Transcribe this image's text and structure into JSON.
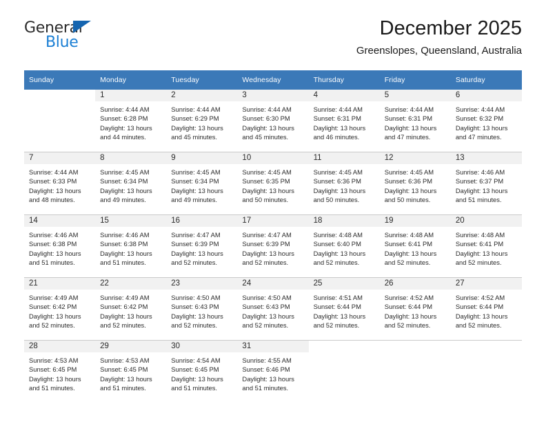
{
  "brand": {
    "name_part1": "General",
    "name_part2": "Blue",
    "accent_color": "#1b7fd4",
    "triangle_color": "#1565b0"
  },
  "header": {
    "title": "December 2025",
    "subtitle": "Greenslopes, Queensland, Australia"
  },
  "calendar": {
    "header_bg": "#3b79b8",
    "daynum_bg": "#f1f1f1",
    "weekday_headers": [
      "Sunday",
      "Monday",
      "Tuesday",
      "Wednesday",
      "Thursday",
      "Friday",
      "Saturday"
    ],
    "weeks": [
      [
        {
          "day": "",
          "blank": true,
          "sunrise": "",
          "sunset": "",
          "daylight_l1": "",
          "daylight_l2": ""
        },
        {
          "day": "1",
          "sunrise": "Sunrise: 4:44 AM",
          "sunset": "Sunset: 6:28 PM",
          "daylight_l1": "Daylight: 13 hours",
          "daylight_l2": "and 44 minutes."
        },
        {
          "day": "2",
          "sunrise": "Sunrise: 4:44 AM",
          "sunset": "Sunset: 6:29 PM",
          "daylight_l1": "Daylight: 13 hours",
          "daylight_l2": "and 45 minutes."
        },
        {
          "day": "3",
          "sunrise": "Sunrise: 4:44 AM",
          "sunset": "Sunset: 6:30 PM",
          "daylight_l1": "Daylight: 13 hours",
          "daylight_l2": "and 45 minutes."
        },
        {
          "day": "4",
          "sunrise": "Sunrise: 4:44 AM",
          "sunset": "Sunset: 6:31 PM",
          "daylight_l1": "Daylight: 13 hours",
          "daylight_l2": "and 46 minutes."
        },
        {
          "day": "5",
          "sunrise": "Sunrise: 4:44 AM",
          "sunset": "Sunset: 6:31 PM",
          "daylight_l1": "Daylight: 13 hours",
          "daylight_l2": "and 47 minutes."
        },
        {
          "day": "6",
          "sunrise": "Sunrise: 4:44 AM",
          "sunset": "Sunset: 6:32 PM",
          "daylight_l1": "Daylight: 13 hours",
          "daylight_l2": "and 47 minutes."
        }
      ],
      [
        {
          "day": "7",
          "sunrise": "Sunrise: 4:44 AM",
          "sunset": "Sunset: 6:33 PM",
          "daylight_l1": "Daylight: 13 hours",
          "daylight_l2": "and 48 minutes."
        },
        {
          "day": "8",
          "sunrise": "Sunrise: 4:45 AM",
          "sunset": "Sunset: 6:34 PM",
          "daylight_l1": "Daylight: 13 hours",
          "daylight_l2": "and 49 minutes."
        },
        {
          "day": "9",
          "sunrise": "Sunrise: 4:45 AM",
          "sunset": "Sunset: 6:34 PM",
          "daylight_l1": "Daylight: 13 hours",
          "daylight_l2": "and 49 minutes."
        },
        {
          "day": "10",
          "sunrise": "Sunrise: 4:45 AM",
          "sunset": "Sunset: 6:35 PM",
          "daylight_l1": "Daylight: 13 hours",
          "daylight_l2": "and 50 minutes."
        },
        {
          "day": "11",
          "sunrise": "Sunrise: 4:45 AM",
          "sunset": "Sunset: 6:36 PM",
          "daylight_l1": "Daylight: 13 hours",
          "daylight_l2": "and 50 minutes."
        },
        {
          "day": "12",
          "sunrise": "Sunrise: 4:45 AM",
          "sunset": "Sunset: 6:36 PM",
          "daylight_l1": "Daylight: 13 hours",
          "daylight_l2": "and 50 minutes."
        },
        {
          "day": "13",
          "sunrise": "Sunrise: 4:46 AM",
          "sunset": "Sunset: 6:37 PM",
          "daylight_l1": "Daylight: 13 hours",
          "daylight_l2": "and 51 minutes."
        }
      ],
      [
        {
          "day": "14",
          "sunrise": "Sunrise: 4:46 AM",
          "sunset": "Sunset: 6:38 PM",
          "daylight_l1": "Daylight: 13 hours",
          "daylight_l2": "and 51 minutes."
        },
        {
          "day": "15",
          "sunrise": "Sunrise: 4:46 AM",
          "sunset": "Sunset: 6:38 PM",
          "daylight_l1": "Daylight: 13 hours",
          "daylight_l2": "and 51 minutes."
        },
        {
          "day": "16",
          "sunrise": "Sunrise: 4:47 AM",
          "sunset": "Sunset: 6:39 PM",
          "daylight_l1": "Daylight: 13 hours",
          "daylight_l2": "and 52 minutes."
        },
        {
          "day": "17",
          "sunrise": "Sunrise: 4:47 AM",
          "sunset": "Sunset: 6:39 PM",
          "daylight_l1": "Daylight: 13 hours",
          "daylight_l2": "and 52 minutes."
        },
        {
          "day": "18",
          "sunrise": "Sunrise: 4:48 AM",
          "sunset": "Sunset: 6:40 PM",
          "daylight_l1": "Daylight: 13 hours",
          "daylight_l2": "and 52 minutes."
        },
        {
          "day": "19",
          "sunrise": "Sunrise: 4:48 AM",
          "sunset": "Sunset: 6:41 PM",
          "daylight_l1": "Daylight: 13 hours",
          "daylight_l2": "and 52 minutes."
        },
        {
          "day": "20",
          "sunrise": "Sunrise: 4:48 AM",
          "sunset": "Sunset: 6:41 PM",
          "daylight_l1": "Daylight: 13 hours",
          "daylight_l2": "and 52 minutes."
        }
      ],
      [
        {
          "day": "21",
          "sunrise": "Sunrise: 4:49 AM",
          "sunset": "Sunset: 6:42 PM",
          "daylight_l1": "Daylight: 13 hours",
          "daylight_l2": "and 52 minutes."
        },
        {
          "day": "22",
          "sunrise": "Sunrise: 4:49 AM",
          "sunset": "Sunset: 6:42 PM",
          "daylight_l1": "Daylight: 13 hours",
          "daylight_l2": "and 52 minutes."
        },
        {
          "day": "23",
          "sunrise": "Sunrise: 4:50 AM",
          "sunset": "Sunset: 6:43 PM",
          "daylight_l1": "Daylight: 13 hours",
          "daylight_l2": "and 52 minutes."
        },
        {
          "day": "24",
          "sunrise": "Sunrise: 4:50 AM",
          "sunset": "Sunset: 6:43 PM",
          "daylight_l1": "Daylight: 13 hours",
          "daylight_l2": "and 52 minutes."
        },
        {
          "day": "25",
          "sunrise": "Sunrise: 4:51 AM",
          "sunset": "Sunset: 6:44 PM",
          "daylight_l1": "Daylight: 13 hours",
          "daylight_l2": "and 52 minutes."
        },
        {
          "day": "26",
          "sunrise": "Sunrise: 4:52 AM",
          "sunset": "Sunset: 6:44 PM",
          "daylight_l1": "Daylight: 13 hours",
          "daylight_l2": "and 52 minutes."
        },
        {
          "day": "27",
          "sunrise": "Sunrise: 4:52 AM",
          "sunset": "Sunset: 6:44 PM",
          "daylight_l1": "Daylight: 13 hours",
          "daylight_l2": "and 52 minutes."
        }
      ],
      [
        {
          "day": "28",
          "sunrise": "Sunrise: 4:53 AM",
          "sunset": "Sunset: 6:45 PM",
          "daylight_l1": "Daylight: 13 hours",
          "daylight_l2": "and 51 minutes."
        },
        {
          "day": "29",
          "sunrise": "Sunrise: 4:53 AM",
          "sunset": "Sunset: 6:45 PM",
          "daylight_l1": "Daylight: 13 hours",
          "daylight_l2": "and 51 minutes."
        },
        {
          "day": "30",
          "sunrise": "Sunrise: 4:54 AM",
          "sunset": "Sunset: 6:45 PM",
          "daylight_l1": "Daylight: 13 hours",
          "daylight_l2": "and 51 minutes."
        },
        {
          "day": "31",
          "sunrise": "Sunrise: 4:55 AM",
          "sunset": "Sunset: 6:46 PM",
          "daylight_l1": "Daylight: 13 hours",
          "daylight_l2": "and 51 minutes."
        },
        {
          "day": "",
          "blank": true,
          "sunrise": "",
          "sunset": "",
          "daylight_l1": "",
          "daylight_l2": ""
        },
        {
          "day": "",
          "blank": true,
          "sunrise": "",
          "sunset": "",
          "daylight_l1": "",
          "daylight_l2": ""
        },
        {
          "day": "",
          "blank": true,
          "sunrise": "",
          "sunset": "",
          "daylight_l1": "",
          "daylight_l2": ""
        }
      ]
    ]
  }
}
